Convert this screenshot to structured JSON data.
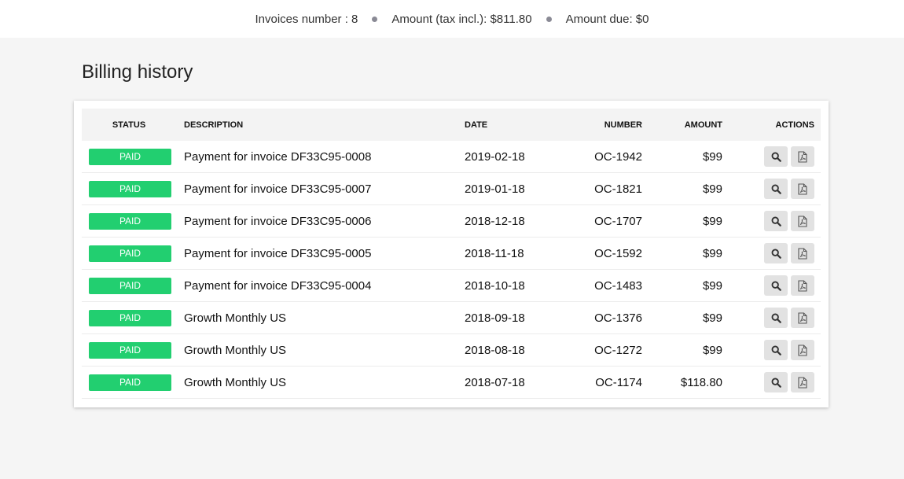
{
  "summary": {
    "invoices_number": "Invoices number : 8",
    "amount_tax_incl": "Amount (tax incl.): $811.80",
    "amount_due": "Amount due: $0"
  },
  "page_title": "Billing history",
  "table": {
    "headers": {
      "status": "STATUS",
      "description": "DESCRIPTION",
      "date": "DATE",
      "number": "NUMBER",
      "amount": "AMOUNT",
      "actions": "ACTIONS"
    },
    "rows": [
      {
        "status": "PAID",
        "description": "Payment for invoice DF33C95-0008",
        "date": "2019-02-18",
        "number": "OC-1942",
        "amount": "$99"
      },
      {
        "status": "PAID",
        "description": "Payment for invoice DF33C95-0007",
        "date": "2019-01-18",
        "number": "OC-1821",
        "amount": "$99"
      },
      {
        "status": "PAID",
        "description": "Payment for invoice DF33C95-0006",
        "date": "2018-12-18",
        "number": "OC-1707",
        "amount": "$99"
      },
      {
        "status": "PAID",
        "description": "Payment for invoice DF33C95-0005",
        "date": "2018-11-18",
        "number": "OC-1592",
        "amount": "$99"
      },
      {
        "status": "PAID",
        "description": "Payment for invoice DF33C95-0004",
        "date": "2018-10-18",
        "number": "OC-1483",
        "amount": "$99"
      },
      {
        "status": "PAID",
        "description": "Growth Monthly US",
        "date": "2018-09-18",
        "number": "OC-1376",
        "amount": "$99"
      },
      {
        "status": "PAID",
        "description": "Growth Monthly US",
        "date": "2018-08-18",
        "number": "OC-1272",
        "amount": "$99"
      },
      {
        "status": "PAID",
        "description": "Growth Monthly US",
        "date": "2018-07-18",
        "number": "OC-1174",
        "amount": "$118.80"
      }
    ]
  },
  "icons": {
    "view": "search-icon",
    "download": "pdf-icon"
  },
  "colors": {
    "paid_badge": "#22cf70",
    "action_button": "#e2e2e2"
  }
}
